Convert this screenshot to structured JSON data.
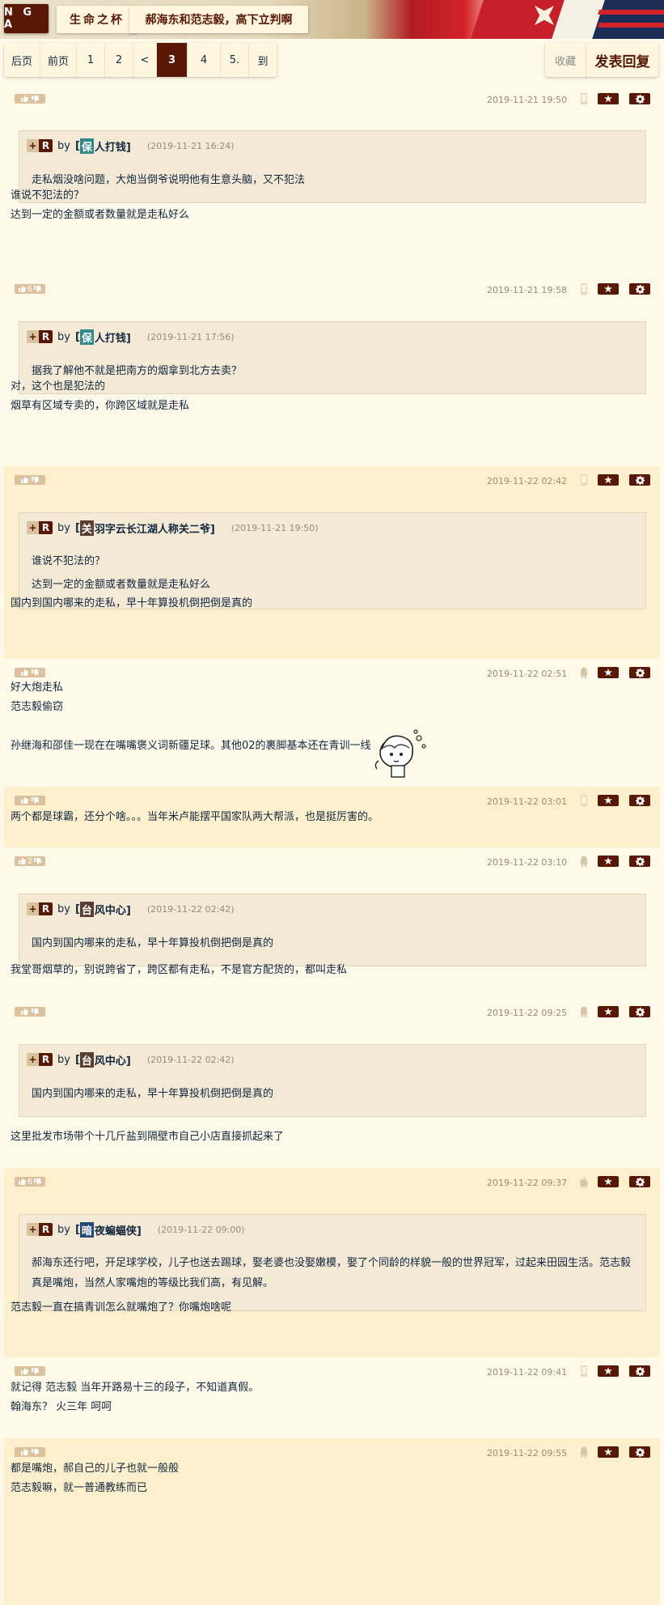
{
  "header": {
    "logo": "N G A",
    "forum": "生命之杯",
    "topic": "郝海东和范志毅，高下立判啊"
  },
  "pager": {
    "items": [
      "后页",
      "前页",
      "1",
      "2",
      "<",
      "3",
      "4",
      "5.",
      "到"
    ],
    "current": "3",
    "fav": "收藏",
    "reply": "发表回复"
  },
  "posts": [
    {
      "votes": "",
      "date": "2019-11-21 19:50",
      "device": "phone-icon",
      "quote": {
        "user_char": "保",
        "user_rest": "人打钱]",
        "time": "(2019-11-21 16:24)",
        "lines": [
          "走私烟没啥问题，大炮当倒爷说明他有生意头脑，又不犯法"
        ]
      },
      "lines": [
        "谁说不犯法的？",
        "达到一定的金额或者数量就是走私好么"
      ]
    },
    {
      "votes": "6",
      "date": "2019-11-21 19:58",
      "device": "phone-icon",
      "quote": {
        "user_char": "保",
        "user_rest": "人打钱]",
        "time": "(2019-11-21 17:56)",
        "lines": [
          "据我了解他不就是把南方的烟拿到北方去卖？"
        ]
      },
      "lines": [
        "对，这个也是犯法的",
        "烟草有区域专卖的，你跨区域就是走私"
      ]
    },
    {
      "votes": "",
      "date": "2019-11-22 02:42",
      "device": "phone-icon",
      "quote": {
        "user_char": "关",
        "user_rest": "羽字云长江湖人称关二爷]",
        "time": "(2019-11-21 19:50)",
        "lines": [
          "谁说不犯法的？",
          "达到一定的金额或者数量就是走私好么"
        ]
      },
      "lines": [
        "国内到国内哪来的走私，早十年算投机倒把倒是真的"
      ]
    },
    {
      "votes": "",
      "date": "2019-11-22 02:51",
      "device": "android-icon",
      "lines": [
        "好大炮走私",
        "范志毅偷窃",
        "",
        "孙继海和邵佳一现在在嘴嘴褒义词新疆足球。其他02的裹脚基本还在青训一线"
      ]
    },
    {
      "votes": "",
      "date": "2019-11-22 03:01",
      "device": "phone-icon",
      "lines": [
        "两个都是球霸，还分个啥。。。当年米卢能摆平国家队两大帮派，也是挺厉害的。"
      ]
    },
    {
      "votes": "2",
      "date": "2019-11-22 03:10",
      "device": "android-icon",
      "quote": {
        "user_char": "台",
        "user_rest": "风中心]",
        "time": "(2019-11-22 02:42)",
        "lines": [
          "国内到国内哪来的走私，早十年算投机倒把倒是真的"
        ]
      },
      "lines": [
        "我堂哥烟草的，别说跨省了，跨区都有走私，不是官方配货的，都叫走私"
      ]
    },
    {
      "votes": "",
      "date": "2019-11-22 09:25",
      "device": "android-icon",
      "quote": {
        "user_char": "台",
        "user_rest": "风中心]",
        "time": "(2019-11-22 02:42)",
        "lines": [
          "国内到国内哪来的走私，早十年算投机倒把倒是真的"
        ]
      },
      "lines": [
        "这里批发市场带个十几斤盐到隔壁市自己小店直接抓起来了"
      ]
    },
    {
      "votes": "6",
      "date": "2019-11-22 09:37",
      "device": "apple-icon",
      "quote": {
        "user_char": "暗",
        "user_rest": "夜蝙蝠侠]",
        "time": "(2019-11-22 09:00)",
        "lines": [
          "郝海东还行吧，开足球学校，儿子也送去踢球，娶老婆也没娶嫩模，娶了个同龄的样貌一般的世界冠军，过起来田园生活。范志毅",
          "真是嘴炮，当然人家嘴炮的等级比我们高，有见解。"
        ]
      },
      "lines": [
        "范志毅一直在搞青训怎么就嘴炮了？你嘴炮啥呢"
      ]
    },
    {
      "votes": "",
      "date": "2019-11-22 09:41",
      "device": "phone-icon",
      "lines": [
        "就记得 范志毅 当年开路易十三的段子，不知道真假。",
        "翰海东？ 火三年 呵呵"
      ]
    },
    {
      "votes": "",
      "date": "2019-11-22 09:55",
      "device": "android-icon",
      "lines": [
        "都是嘴炮，郝自己的儿子也就一般般",
        "范志毅嘛，就一普通教练而已"
      ]
    }
  ]
}
